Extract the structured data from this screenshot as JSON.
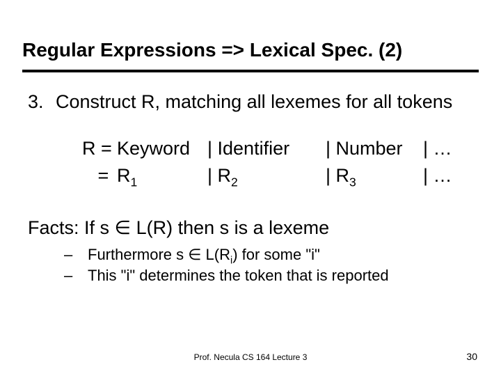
{
  "title": "Regular Expressions => Lexical Spec. (2)",
  "item3": {
    "num": "3.",
    "text": "Construct R, matching all lexemes for all tokens"
  },
  "grammar": {
    "r1": {
      "c0": "R =",
      "c1": "Keyword",
      "c2": "| Identifier",
      "c3": "| Number",
      "c4": "| …"
    },
    "r2": {
      "c0": "   =",
      "c1_pre": "R",
      "c1_sub": "1",
      "c2_pre": "| R",
      "c2_sub": "2",
      "c3_pre": "| R",
      "c3_sub": "3",
      "c4": "| …"
    }
  },
  "facts": {
    "pre": "Facts: If s ",
    "elem": "∈",
    "mid": " L(R) then s is a lexeme"
  },
  "sub1": {
    "dash": "–",
    "pre": "Furthermore s ",
    "elem": "∈",
    "mid": " L(R",
    "sub": "i",
    "post": ") for some \"i\""
  },
  "sub2": {
    "dash": "–",
    "text": "This \"i\" determines the token that is reported"
  },
  "footer": {
    "center": "Prof. Necula  CS 164  Lecture 3",
    "page": "30"
  }
}
